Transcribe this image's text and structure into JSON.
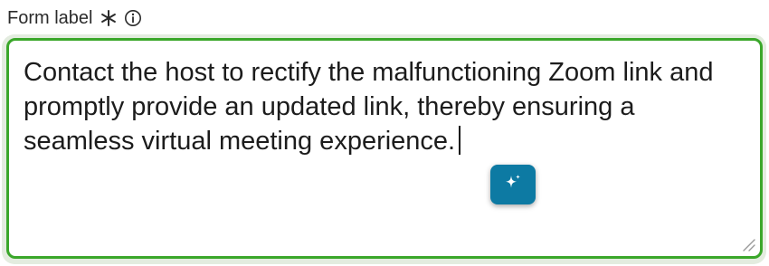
{
  "form": {
    "label": "Form label",
    "required_icon": "asterisk-icon",
    "info_icon": "info-icon",
    "value": "Contact the host to rectify the malfunctioning Zoom link and promptly provide an updated link, thereby ensuring a seamless virtual meeting experience.",
    "ai_button_icon": "sparkle-icon",
    "resize_icon": "resize-grip-icon"
  },
  "colors": {
    "border_focus": "#3aa72a",
    "focus_ring": "#e3ecdf",
    "ai_button": "#0d7aa3"
  }
}
